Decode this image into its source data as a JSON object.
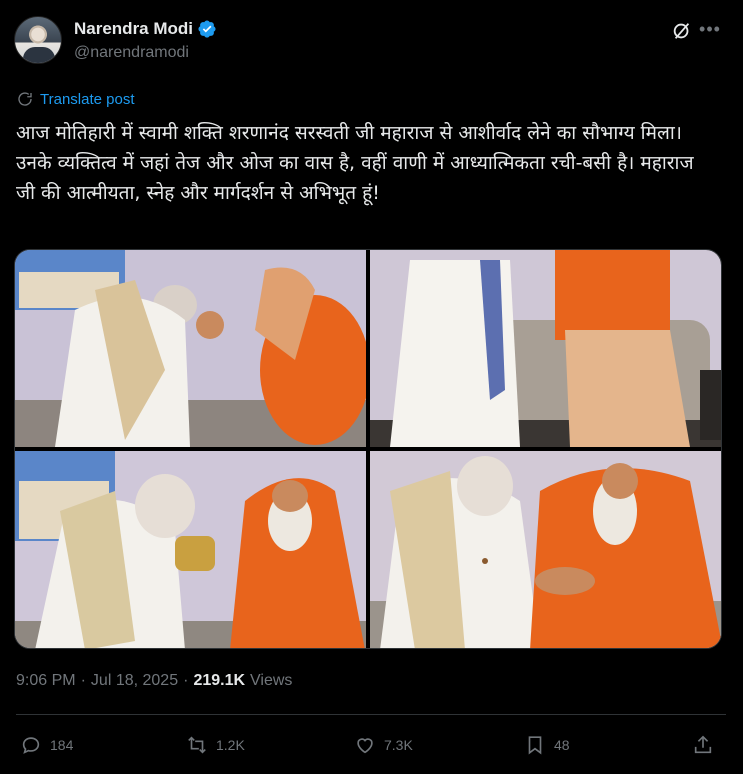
{
  "author": {
    "name": "Narendra Modi",
    "handle": "@narendramodi",
    "verified_color": "#1d9bf0"
  },
  "header": {
    "grok_icon": "grok-icon",
    "more_icon": "more-icon",
    "more_label": "•••"
  },
  "translate": {
    "label": "Translate post",
    "icon": "globe-icon"
  },
  "post": {
    "text": "आज मोतिहारी में स्वामी शक्ति शरणानंद सरस्वती जी महाराज से आशीर्वाद लेने का सौभाग्य मिला। उनके व्यक्तित्व में जहां तेज और ओज का वास है, वहीं वाणी में आध्यात्मिकता रची-बसी है। महाराज जी की आत्मीयता, स्नेह और मार्गदर्शन से अभिभूत हूं!"
  },
  "media": {
    "photo_count": 4
  },
  "meta": {
    "time": "9:06 PM",
    "separator": "·",
    "date": "Jul 18, 2025",
    "views_count": "219.1K",
    "views_label": "Views"
  },
  "actions": {
    "replies": "184",
    "reposts": "1.2K",
    "likes": "7.3K",
    "bookmarks": "48"
  },
  "colors": {
    "background": "#000000",
    "text": "#e7e9ea",
    "muted": "#71767b",
    "accent": "#1d9bf0",
    "robe": "#e8641c"
  }
}
